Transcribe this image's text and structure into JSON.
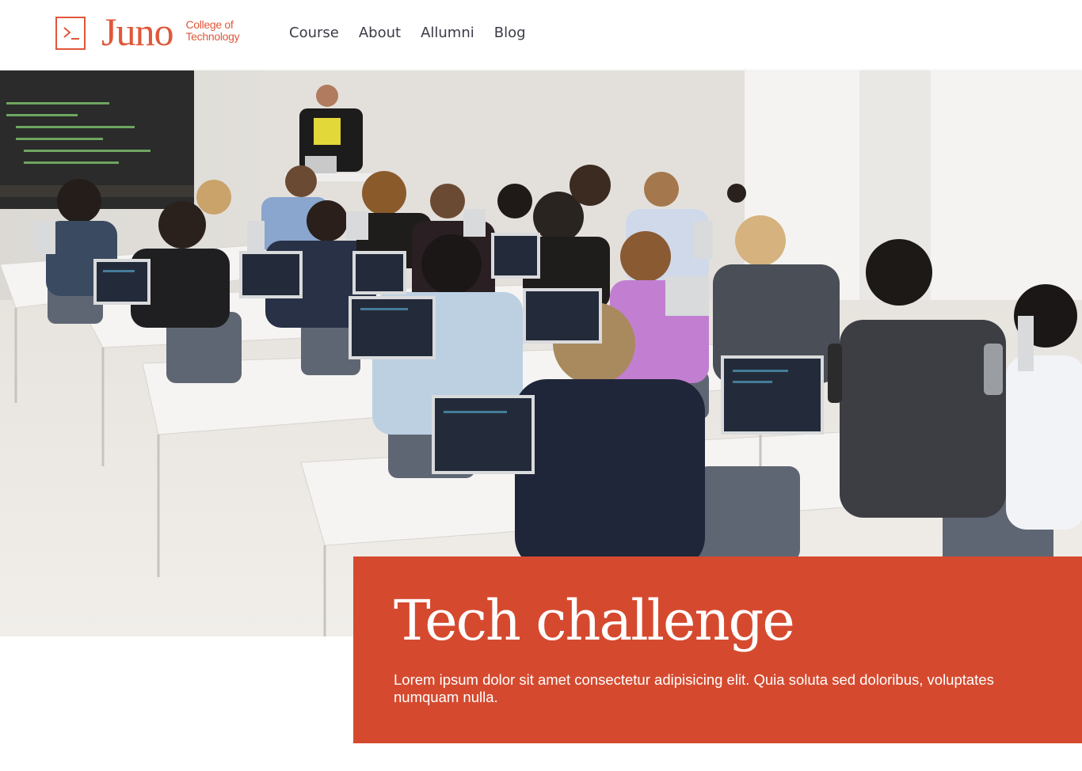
{
  "brand": {
    "name": "Juno",
    "subtitle": "College of Technology",
    "icon": "terminal-prompt-icon",
    "accent_color": "#e0573a"
  },
  "nav": {
    "items": [
      {
        "label": "Course"
      },
      {
        "label": "About"
      },
      {
        "label": "Allumni"
      },
      {
        "label": "Blog"
      }
    ]
  },
  "hero": {
    "image": "classroom-photo"
  },
  "feature": {
    "title": "Tech challenge",
    "body": "Lorem ipsum dolor sit amet consectetur adipisicing elit. Quia soluta sed doloribus, voluptates numquam nulla.",
    "background_color": "#d54a2f"
  }
}
